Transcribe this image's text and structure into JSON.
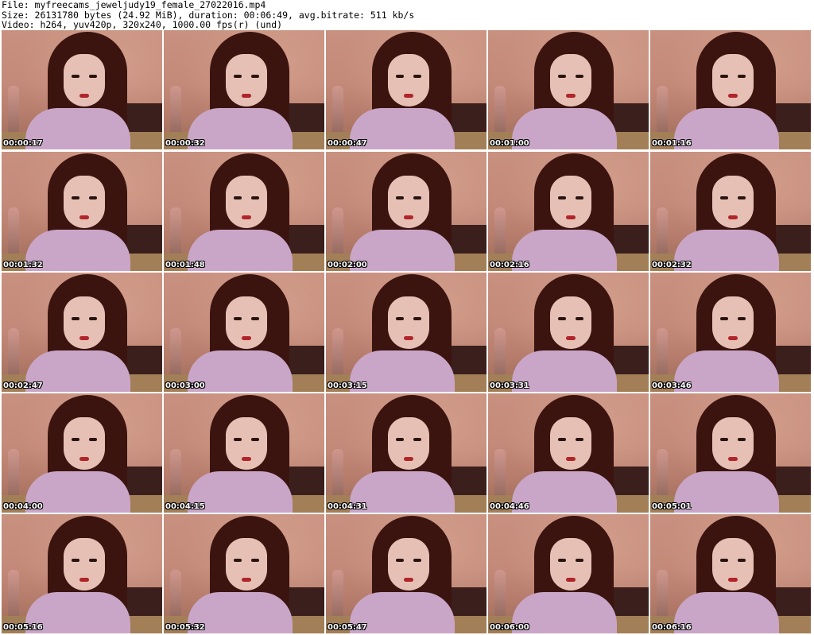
{
  "header": {
    "file_line": "File: myfreecams_jeweljudy19_female_27022016.mp4",
    "size_line": "Size: 26131780 bytes (24.92 MiB), duration: 00:06:49, avg.bitrate: 511 kb/s",
    "video_line": "Video: h264, yuv420p, 320x240, 1000.00 fps(r) (und)"
  },
  "thumbnails": [
    "00:00:17",
    "00:00:32",
    "00:00:47",
    "00:01:00",
    "00:01:16",
    "00:01:32",
    "00:01:48",
    "00:02:00",
    "00:02:16",
    "00:02:32",
    "00:02:47",
    "00:03:00",
    "00:03:15",
    "00:03:31",
    "00:03:46",
    "00:04:00",
    "00:04:15",
    "00:04:31",
    "00:04:46",
    "00:05:01",
    "00:05:16",
    "00:05:32",
    "00:05:47",
    "00:06:00",
    "00:06:16"
  ]
}
